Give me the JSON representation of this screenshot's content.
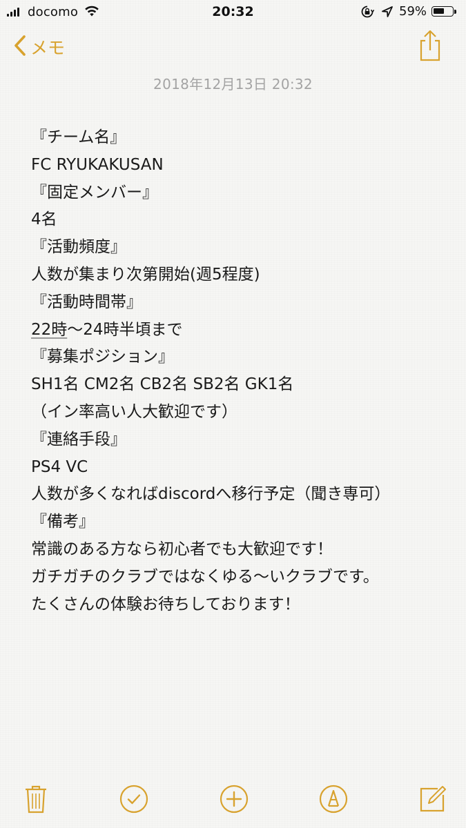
{
  "status_bar": {
    "carrier": "docomo",
    "time": "20:32",
    "battery_percent": "59%",
    "battery_level": 0.59,
    "signal_bars": 4
  },
  "nav": {
    "back_label": "メモ",
    "back_icon": "chevron-left-icon",
    "share_icon": "share-icon"
  },
  "note": {
    "date": "2018年12月13日 20:32",
    "lines": [
      "『チーム名』",
      "FC RYUKAKUSAN",
      "『固定メンバー』",
      "4名",
      "『活動頻度』",
      "人数が集まり次第開始(週5程度)",
      "『活動時間帯』",
      "22時〜24時半頃まで",
      "『募集ポジション』",
      "SH1名 CM2名 CB2名 SB2名 GK1名",
      "（イン率高い人大歓迎です）",
      "『連絡手段』",
      "PS4 VC",
      "人数が多くなればdiscordへ移行予定（聞き専可）",
      "『備考』",
      "常識のある方なら初心者でも大歓迎です！",
      "ガチガチのクラブではなくゆる〜いクラブです。",
      "たくさんの体験お待ちしております！"
    ]
  },
  "toolbar": {
    "items": [
      "trash-icon",
      "checklist-icon",
      "add-icon",
      "markup-icon",
      "compose-icon"
    ]
  },
  "colors": {
    "accent": "#d8a22e",
    "date_text": "#a3a3a3",
    "body_text": "#1a1a1a",
    "background": "#f6f6f4"
  }
}
